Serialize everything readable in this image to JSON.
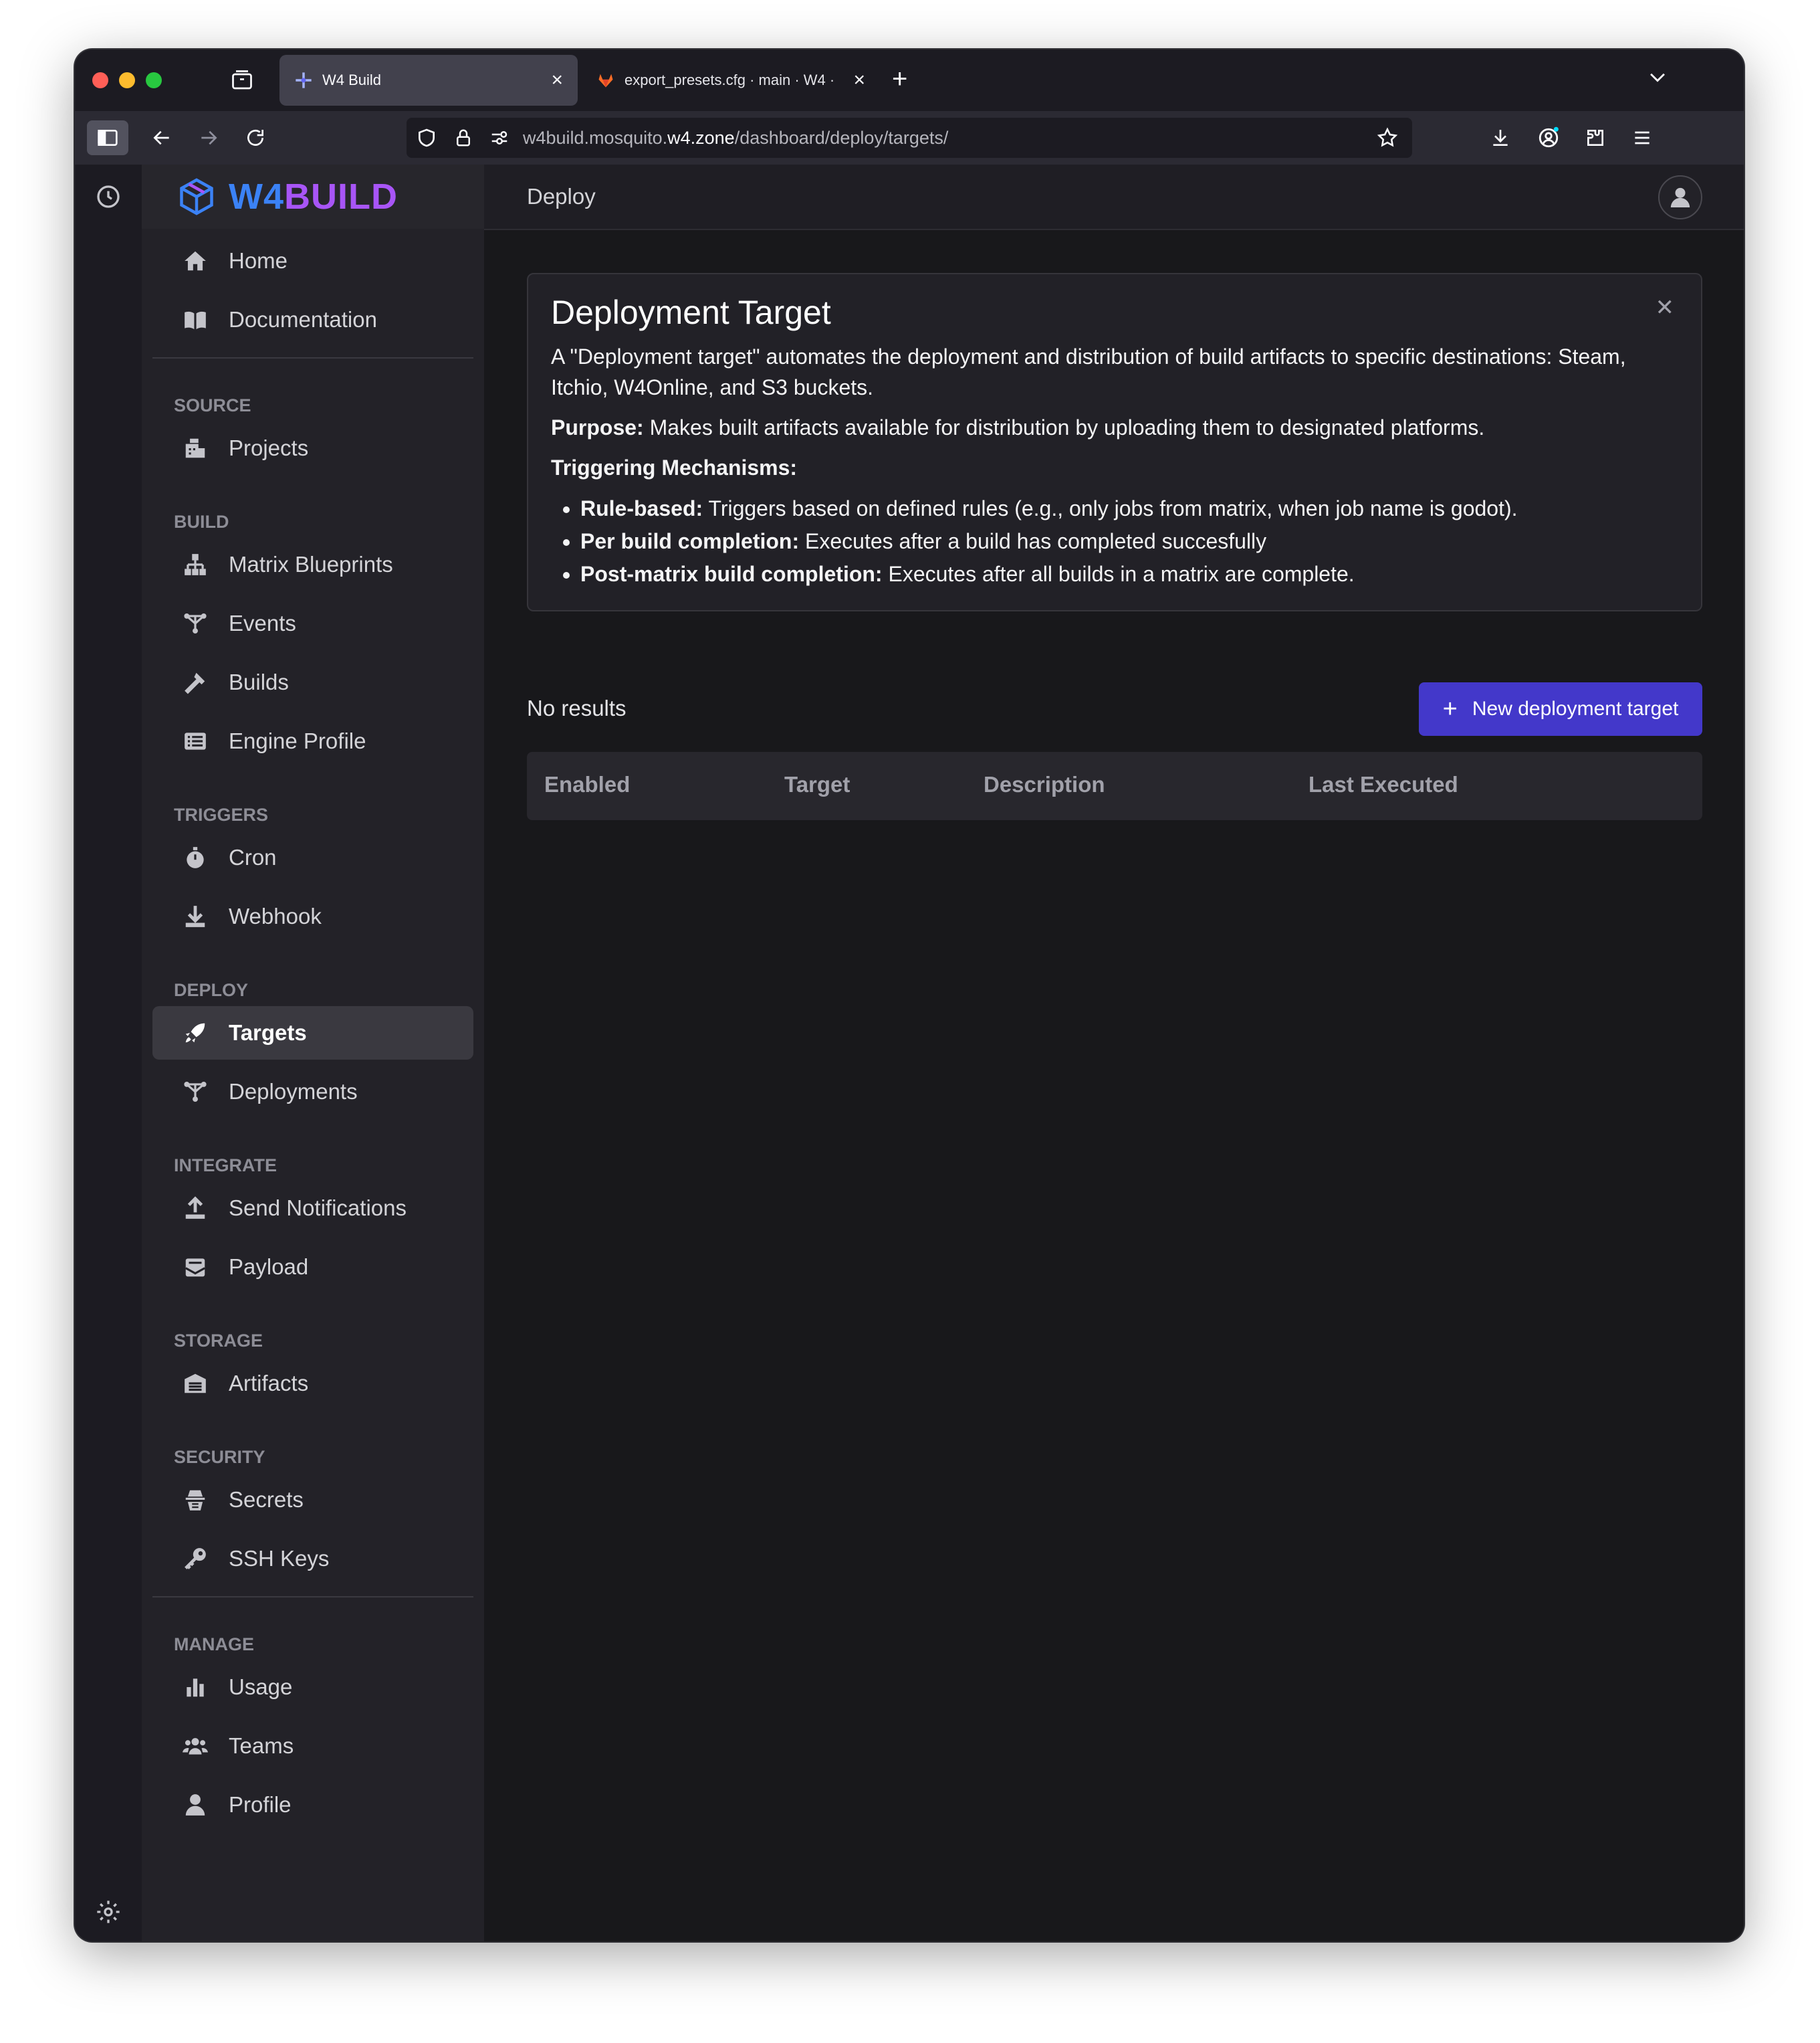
{
  "browser": {
    "tabs": [
      {
        "title": "W4 Build",
        "active": true
      },
      {
        "title": "export_presets.cfg · main · W4 ·",
        "active": false
      }
    ],
    "url": {
      "prefix": "w4build.mosquito.",
      "host": "w4.zone",
      "path": "/dashboard/deploy/targets/"
    }
  },
  "app": {
    "brand": {
      "part1": "W4",
      "part2": "BUILD"
    },
    "top_items": [
      {
        "label": "Home",
        "icon": "home-icon"
      },
      {
        "label": "Documentation",
        "icon": "book-icon"
      }
    ],
    "sections": [
      {
        "label": "SOURCE",
        "items": [
          {
            "label": "Projects",
            "icon": "projects-icon"
          }
        ]
      },
      {
        "label": "BUILD",
        "items": [
          {
            "label": "Matrix Blueprints",
            "icon": "sitemap-icon"
          },
          {
            "label": "Events",
            "icon": "events-icon"
          },
          {
            "label": "Builds",
            "icon": "hammer-icon"
          },
          {
            "label": "Engine Profile",
            "icon": "list-icon"
          }
        ]
      },
      {
        "label": "TRIGGERS",
        "items": [
          {
            "label": "Cron",
            "icon": "stopwatch-icon"
          },
          {
            "label": "Webhook",
            "icon": "download-icon"
          }
        ]
      },
      {
        "label": "DEPLOY",
        "items": [
          {
            "label": "Targets",
            "icon": "rocket-icon",
            "active": true
          },
          {
            "label": "Deployments",
            "icon": "deployments-icon"
          }
        ]
      },
      {
        "label": "INTEGRATE",
        "items": [
          {
            "label": "Send Notifications",
            "icon": "upload-icon"
          },
          {
            "label": "Payload",
            "icon": "envelope-icon"
          }
        ]
      },
      {
        "label": "STORAGE",
        "items": [
          {
            "label": "Artifacts",
            "icon": "warehouse-icon"
          }
        ]
      },
      {
        "label": "SECURITY",
        "items": [
          {
            "label": "Secrets",
            "icon": "spy-icon"
          },
          {
            "label": "SSH Keys",
            "icon": "key-icon"
          }
        ]
      },
      {
        "label": "MANAGE",
        "items": [
          {
            "label": "Usage",
            "icon": "bar-chart-icon"
          },
          {
            "label": "Teams",
            "icon": "users-icon"
          },
          {
            "label": "Profile",
            "icon": "user-icon"
          }
        ]
      }
    ]
  },
  "page": {
    "breadcrumb": "Deploy",
    "info": {
      "title": "Deployment Target",
      "intro": "A \"Deployment target\" automates the deployment and distribution of build artifacts to specific destinations: Steam, Itchio, W4Online, and S3 buckets.",
      "purpose_label": "Purpose:",
      "purpose_text": " Makes built artifacts available for distribution by uploading them to designated platforms.",
      "mechanisms_title": "Triggering Mechanisms:",
      "mechanisms": [
        {
          "label": "Rule-based:",
          "text": " Triggers based on defined rules (e.g., only jobs from matrix, when job name is godot)."
        },
        {
          "label": "Per build completion:",
          "text": " Executes after a build has completed succesfully"
        },
        {
          "label": "Post-matrix build completion:",
          "text": " Executes after all builds in a matrix are complete."
        }
      ]
    },
    "results_text": "No results",
    "new_button": "New deployment target",
    "columns": [
      "Enabled",
      "Target",
      "Description",
      "Last Executed"
    ]
  },
  "colors": {
    "accent": "#4338ca",
    "brand_blue": "#3b82f6",
    "brand_purple": "#a855f7"
  }
}
